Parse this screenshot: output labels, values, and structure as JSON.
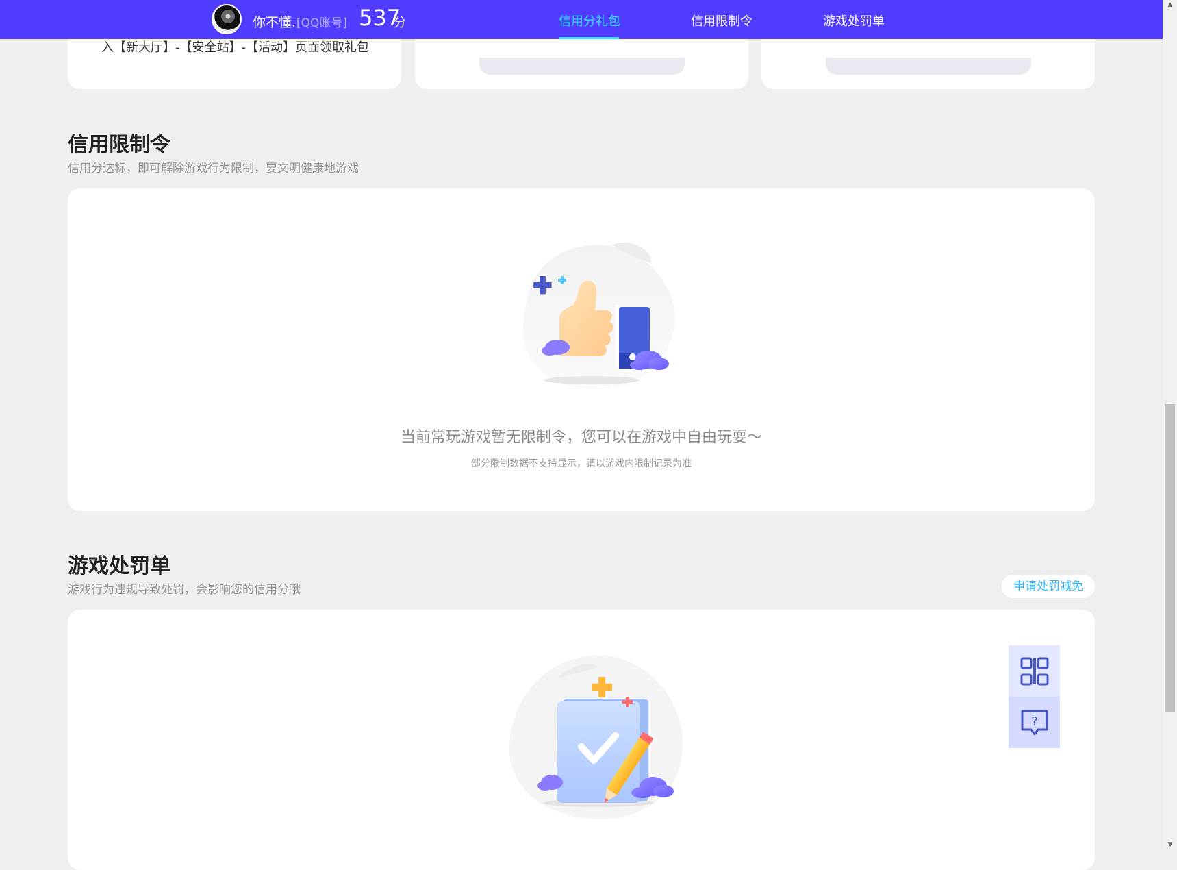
{
  "header": {
    "nickname": "你不懂.",
    "account_type": "[QQ账号]",
    "score": "537",
    "score_unit": "分",
    "nav": [
      {
        "label": "信用分礼包",
        "active": true
      },
      {
        "label": "信用限制令",
        "active": false
      },
      {
        "label": "游戏处罚单",
        "active": false
      }
    ]
  },
  "gift_cards": {
    "card1_text": "入【新大厅】-【安全站】-【活动】页面领取礼包"
  },
  "restriction": {
    "title": "信用限制令",
    "desc": "信用分达标，即可解除游戏行为限制，要文明健康地游戏",
    "empty_main": "当前常玩游戏暂无限制令，您可以在游戏中自由玩耍～",
    "empty_sub": "部分限制数据不支持显示，请以游戏内限制记录为准"
  },
  "penalty": {
    "title": "游戏处罚单",
    "desc": "游戏行为违规导致处罚，会影响您的信用分哦",
    "apply_label": "申请处罚减免"
  },
  "colors": {
    "brand": "#4f3cff",
    "active_nav": "#2fe3ff",
    "link": "#2fb5ff",
    "page_bg": "#efefef"
  },
  "icons": [
    "avatar",
    "thumbs-up-illustration",
    "clipboard-pencil-illustration",
    "qr-code-icon",
    "help-chat-icon"
  ]
}
